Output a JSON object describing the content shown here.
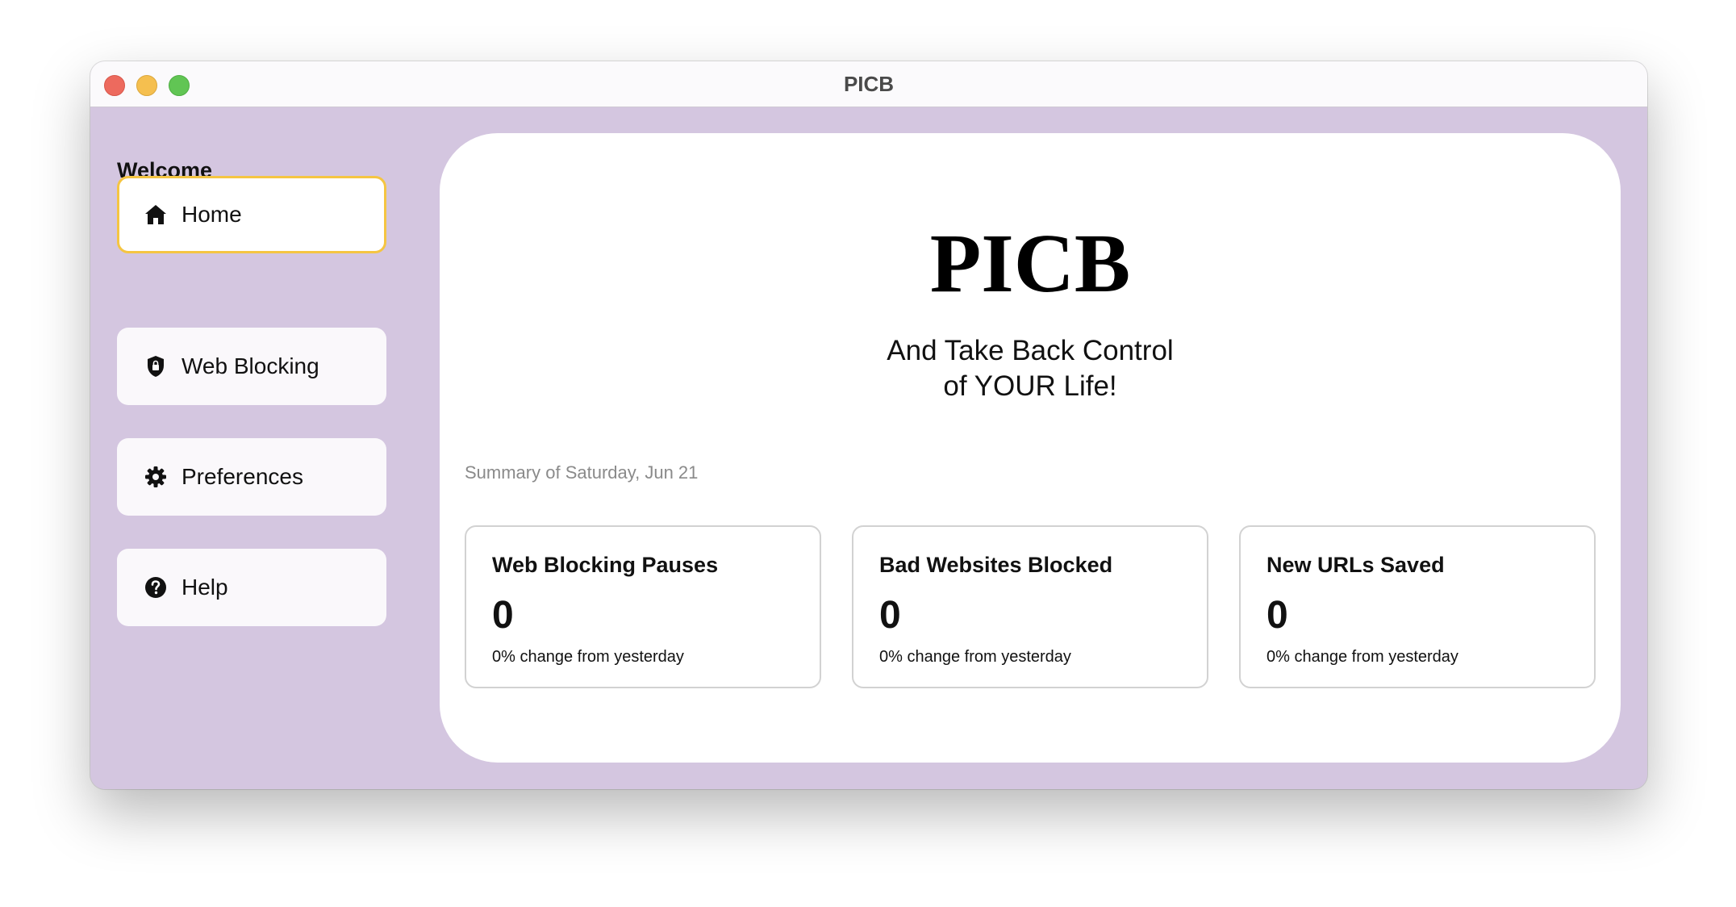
{
  "window": {
    "title": "PICB"
  },
  "sidebar": {
    "heading": "Welcome",
    "items": [
      {
        "label": "Home",
        "icon": "house-icon",
        "active": true
      },
      {
        "label": "Web Blocking",
        "icon": "shield-lock-icon",
        "active": false
      },
      {
        "label": "Preferences",
        "icon": "gear-icon",
        "active": false
      },
      {
        "label": "Help",
        "icon": "question-circle-icon",
        "active": false
      }
    ]
  },
  "main": {
    "brand": "PICB",
    "tagline_line1": "And Take Back Control",
    "tagline_line2": "of YOUR Life!",
    "summary": "Summary of Saturday, Jun 21",
    "stats": [
      {
        "title": "Web Blocking Pauses",
        "value": "0",
        "change": "0% change from yesterday"
      },
      {
        "title": "Bad Websites Blocked",
        "value": "0",
        "change": "0% change from yesterday"
      },
      {
        "title": "New URLs Saved",
        "value": "0",
        "change": "0% change from yesterday"
      }
    ]
  },
  "colors": {
    "background": "#d4c6e0",
    "active_border": "#f5c542",
    "card": "#ffffff"
  }
}
